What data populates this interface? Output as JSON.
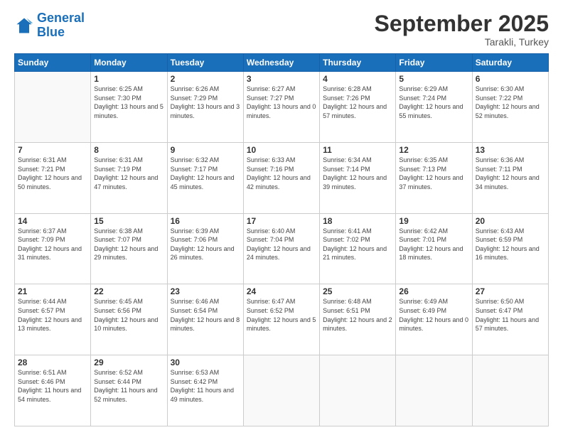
{
  "logo": {
    "line1": "General",
    "line2": "Blue"
  },
  "header": {
    "month": "September 2025",
    "location": "Tarakli, Turkey"
  },
  "weekdays": [
    "Sunday",
    "Monday",
    "Tuesday",
    "Wednesday",
    "Thursday",
    "Friday",
    "Saturday"
  ],
  "weeks": [
    [
      {
        "day": "",
        "sunrise": "",
        "sunset": "",
        "daylight": ""
      },
      {
        "day": "1",
        "sunrise": "Sunrise: 6:25 AM",
        "sunset": "Sunset: 7:30 PM",
        "daylight": "Daylight: 13 hours and 5 minutes."
      },
      {
        "day": "2",
        "sunrise": "Sunrise: 6:26 AM",
        "sunset": "Sunset: 7:29 PM",
        "daylight": "Daylight: 13 hours and 3 minutes."
      },
      {
        "day": "3",
        "sunrise": "Sunrise: 6:27 AM",
        "sunset": "Sunset: 7:27 PM",
        "daylight": "Daylight: 13 hours and 0 minutes."
      },
      {
        "day": "4",
        "sunrise": "Sunrise: 6:28 AM",
        "sunset": "Sunset: 7:26 PM",
        "daylight": "Daylight: 12 hours and 57 minutes."
      },
      {
        "day": "5",
        "sunrise": "Sunrise: 6:29 AM",
        "sunset": "Sunset: 7:24 PM",
        "daylight": "Daylight: 12 hours and 55 minutes."
      },
      {
        "day": "6",
        "sunrise": "Sunrise: 6:30 AM",
        "sunset": "Sunset: 7:22 PM",
        "daylight": "Daylight: 12 hours and 52 minutes."
      }
    ],
    [
      {
        "day": "7",
        "sunrise": "Sunrise: 6:31 AM",
        "sunset": "Sunset: 7:21 PM",
        "daylight": "Daylight: 12 hours and 50 minutes."
      },
      {
        "day": "8",
        "sunrise": "Sunrise: 6:31 AM",
        "sunset": "Sunset: 7:19 PM",
        "daylight": "Daylight: 12 hours and 47 minutes."
      },
      {
        "day": "9",
        "sunrise": "Sunrise: 6:32 AM",
        "sunset": "Sunset: 7:17 PM",
        "daylight": "Daylight: 12 hours and 45 minutes."
      },
      {
        "day": "10",
        "sunrise": "Sunrise: 6:33 AM",
        "sunset": "Sunset: 7:16 PM",
        "daylight": "Daylight: 12 hours and 42 minutes."
      },
      {
        "day": "11",
        "sunrise": "Sunrise: 6:34 AM",
        "sunset": "Sunset: 7:14 PM",
        "daylight": "Daylight: 12 hours and 39 minutes."
      },
      {
        "day": "12",
        "sunrise": "Sunrise: 6:35 AM",
        "sunset": "Sunset: 7:13 PM",
        "daylight": "Daylight: 12 hours and 37 minutes."
      },
      {
        "day": "13",
        "sunrise": "Sunrise: 6:36 AM",
        "sunset": "Sunset: 7:11 PM",
        "daylight": "Daylight: 12 hours and 34 minutes."
      }
    ],
    [
      {
        "day": "14",
        "sunrise": "Sunrise: 6:37 AM",
        "sunset": "Sunset: 7:09 PM",
        "daylight": "Daylight: 12 hours and 31 minutes."
      },
      {
        "day": "15",
        "sunrise": "Sunrise: 6:38 AM",
        "sunset": "Sunset: 7:07 PM",
        "daylight": "Daylight: 12 hours and 29 minutes."
      },
      {
        "day": "16",
        "sunrise": "Sunrise: 6:39 AM",
        "sunset": "Sunset: 7:06 PM",
        "daylight": "Daylight: 12 hours and 26 minutes."
      },
      {
        "day": "17",
        "sunrise": "Sunrise: 6:40 AM",
        "sunset": "Sunset: 7:04 PM",
        "daylight": "Daylight: 12 hours and 24 minutes."
      },
      {
        "day": "18",
        "sunrise": "Sunrise: 6:41 AM",
        "sunset": "Sunset: 7:02 PM",
        "daylight": "Daylight: 12 hours and 21 minutes."
      },
      {
        "day": "19",
        "sunrise": "Sunrise: 6:42 AM",
        "sunset": "Sunset: 7:01 PM",
        "daylight": "Daylight: 12 hours and 18 minutes."
      },
      {
        "day": "20",
        "sunrise": "Sunrise: 6:43 AM",
        "sunset": "Sunset: 6:59 PM",
        "daylight": "Daylight: 12 hours and 16 minutes."
      }
    ],
    [
      {
        "day": "21",
        "sunrise": "Sunrise: 6:44 AM",
        "sunset": "Sunset: 6:57 PM",
        "daylight": "Daylight: 12 hours and 13 minutes."
      },
      {
        "day": "22",
        "sunrise": "Sunrise: 6:45 AM",
        "sunset": "Sunset: 6:56 PM",
        "daylight": "Daylight: 12 hours and 10 minutes."
      },
      {
        "day": "23",
        "sunrise": "Sunrise: 6:46 AM",
        "sunset": "Sunset: 6:54 PM",
        "daylight": "Daylight: 12 hours and 8 minutes."
      },
      {
        "day": "24",
        "sunrise": "Sunrise: 6:47 AM",
        "sunset": "Sunset: 6:52 PM",
        "daylight": "Daylight: 12 hours and 5 minutes."
      },
      {
        "day": "25",
        "sunrise": "Sunrise: 6:48 AM",
        "sunset": "Sunset: 6:51 PM",
        "daylight": "Daylight: 12 hours and 2 minutes."
      },
      {
        "day": "26",
        "sunrise": "Sunrise: 6:49 AM",
        "sunset": "Sunset: 6:49 PM",
        "daylight": "Daylight: 12 hours and 0 minutes."
      },
      {
        "day": "27",
        "sunrise": "Sunrise: 6:50 AM",
        "sunset": "Sunset: 6:47 PM",
        "daylight": "Daylight: 11 hours and 57 minutes."
      }
    ],
    [
      {
        "day": "28",
        "sunrise": "Sunrise: 6:51 AM",
        "sunset": "Sunset: 6:46 PM",
        "daylight": "Daylight: 11 hours and 54 minutes."
      },
      {
        "day": "29",
        "sunrise": "Sunrise: 6:52 AM",
        "sunset": "Sunset: 6:44 PM",
        "daylight": "Daylight: 11 hours and 52 minutes."
      },
      {
        "day": "30",
        "sunrise": "Sunrise: 6:53 AM",
        "sunset": "Sunset: 6:42 PM",
        "daylight": "Daylight: 11 hours and 49 minutes."
      },
      {
        "day": "",
        "sunrise": "",
        "sunset": "",
        "daylight": ""
      },
      {
        "day": "",
        "sunrise": "",
        "sunset": "",
        "daylight": ""
      },
      {
        "day": "",
        "sunrise": "",
        "sunset": "",
        "daylight": ""
      },
      {
        "day": "",
        "sunrise": "",
        "sunset": "",
        "daylight": ""
      }
    ]
  ]
}
